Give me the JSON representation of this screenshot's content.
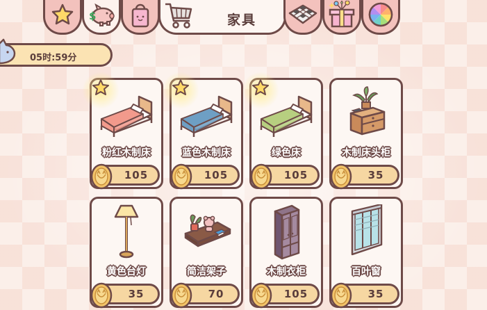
{
  "header": {
    "active_tab_title": "家具",
    "tabs": [
      {
        "icon": "star-icon"
      },
      {
        "icon": "piggy-bank-icon"
      },
      {
        "icon": "shopping-bag-icon"
      },
      {
        "icon": "shopping-cart-icon"
      },
      {
        "icon": "floor-tile-icon"
      },
      {
        "icon": "gift-box-icon"
      },
      {
        "icon": "color-wheel-icon"
      }
    ]
  },
  "timer": {
    "text": "05时:59分"
  },
  "items": [
    {
      "name": "粉红木制床",
      "price": "105",
      "featured": true,
      "art": "bed",
      "color": "#f29a8c"
    },
    {
      "name": "蓝色木制床",
      "price": "105",
      "featured": true,
      "art": "bed",
      "color": "#6e9fc4"
    },
    {
      "name": "绿色床",
      "price": "105",
      "featured": true,
      "art": "bed",
      "color": "#b7cf80"
    },
    {
      "name": "木制床头柜",
      "price": "35",
      "featured": false,
      "art": "nightstand"
    },
    {
      "name": "黄色台灯",
      "price": "35",
      "featured": false,
      "art": "lamp"
    },
    {
      "name": "简洁架子",
      "price": "70",
      "featured": false,
      "art": "shelf"
    },
    {
      "name": "木制衣柜",
      "price": "105",
      "featured": false,
      "art": "wardrobe"
    },
    {
      "name": "百叶窗",
      "price": "35",
      "featured": false,
      "art": "blinds"
    }
  ],
  "colors": {
    "outline": "#6e4a48",
    "tab_pink": "#f3c2bd",
    "price_bg": "#f6d7a2",
    "timer_bg": "#fbe3b3"
  }
}
